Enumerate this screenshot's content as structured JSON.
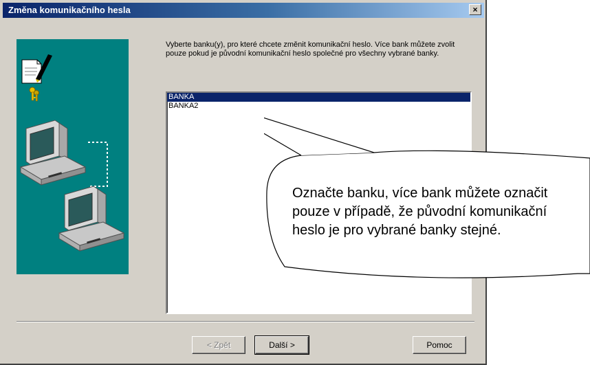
{
  "window": {
    "title": "Změna komunikačního hesla",
    "close_label": "×"
  },
  "instructions": "Vyberte banku(y), pro které chcete změnit komunikační heslo. Více bank můžete zvolit pouze pokud je původní komunikační heslo společné pro všechny vybrané banky.",
  "bank_list": {
    "items": [
      {
        "label": "BANKA",
        "selected": true
      },
      {
        "label": "BANKA2",
        "selected": false
      }
    ]
  },
  "buttons": {
    "back_label": "< Zpět",
    "next_label": "Další >",
    "help_label": "Pomoc"
  },
  "callout": {
    "text": "Označte banku, více bank můžete označit pouze v případě, že původní komunikační heslo je pro vybrané banky stejné."
  },
  "colors": {
    "titlebar_start": "#0a246a",
    "titlebar_end": "#a6caf0",
    "dialog_bg": "#d4d0c8",
    "side_panel_bg": "#008080",
    "selection_bg": "#0a246a"
  },
  "icons": {
    "side_panel": [
      "document-icon",
      "keys-icon",
      "computer-icon",
      "computer-icon"
    ]
  }
}
